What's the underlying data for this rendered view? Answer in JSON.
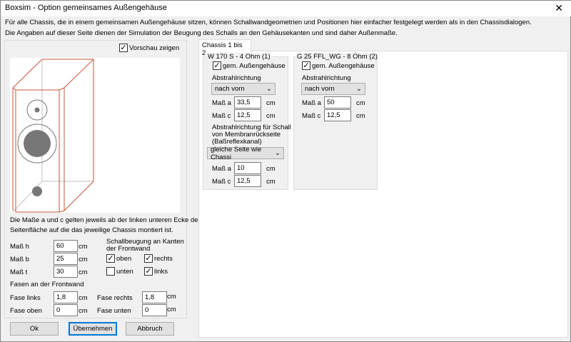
{
  "window": {
    "title": "Boxsim - Option gemeinsames Außengehäuse",
    "close_icon": "close-icon"
  },
  "info": {
    "line1": "Für alle Chassis, die in einem gemeinsamen Außengehäuse sitzen, können Schallwandgeometrien und Positionen hier einfacher festgelegt werden als in den Chassisdialogen.",
    "line2": "Die Angaben auf dieser Seite dienen der Simulation der  Beugung des Schalls an den Gehäusekanten und sind daher Außenmaße."
  },
  "left": {
    "preview_label": "Vorschau zeigen",
    "preview_checked": true,
    "note1": "Die Maße a und c gelten jeweils ab der linken unteren Ecke der",
    "note2": "Seitenfläche auf die das jeweilige Chassis montiert ist.",
    "dims": [
      {
        "label": "Maß h",
        "value": "60",
        "unit": "cm"
      },
      {
        "label": "Maß b",
        "value": "25",
        "unit": "cm"
      },
      {
        "label": "Maß t",
        "value": "30",
        "unit": "cm"
      }
    ],
    "diffraction_title1": "Schallbeugung an Kanten",
    "diffraction_title2": "der Frontwand",
    "edges": {
      "oben": {
        "label": "oben",
        "checked": true
      },
      "rechts": {
        "label": "rechts",
        "checked": true
      },
      "unten": {
        "label": "unten",
        "checked": false
      },
      "links": {
        "label": "links",
        "checked": true
      }
    },
    "bevel_title": "Fasen an der Frontwand",
    "bevels": {
      "links": {
        "label": "Fase links",
        "value": "1,8",
        "unit": "cm"
      },
      "rechts": {
        "label": "Fase rechts",
        "value": "1,8",
        "unit": "cm"
      },
      "oben": {
        "label": "Fase oben",
        "value": "0",
        "unit": "cm"
      },
      "unten": {
        "label": "Fase unten",
        "value": "0",
        "unit": "cm"
      }
    }
  },
  "buttons": {
    "ok": "Ok",
    "apply": "Übernehmen",
    "cancel": "Abbruch"
  },
  "tab": {
    "label": "Chassis 1 bis 2"
  },
  "chassis": [
    {
      "title": "W 170 S - 4 Ohm (1)",
      "shared_label": "gem. Außengehäuse",
      "shared": true,
      "dir_label": "Abstrahlrichtung",
      "dir_value": "nach vorn",
      "a_label": "Maß a",
      "a_value": "33,5",
      "c_label": "Maß c",
      "c_value": "12,5",
      "unit": "cm",
      "rear_label1": "Abstrahlrichtung für Schall",
      "rear_label2": "von Membranrückseite",
      "rear_label3": "(Baßreflexkanal)",
      "rear_value": "gleiche Seite wie Chassi",
      "rear_a_label": "Maß a",
      "rear_a_value": "10",
      "rear_c_label": "Maß c",
      "rear_c_value": "12,5"
    },
    {
      "title": "G 25 FFL_WG - 8 Ohm (2)",
      "shared_label": "gem. Außengehäuse",
      "shared": true,
      "dir_label": "Abstrahlrichtung",
      "dir_value": "nach vorn",
      "a_label": "Maß a",
      "a_value": "50",
      "c_label": "Maß c",
      "c_value": "12,5",
      "unit": "cm"
    }
  ]
}
